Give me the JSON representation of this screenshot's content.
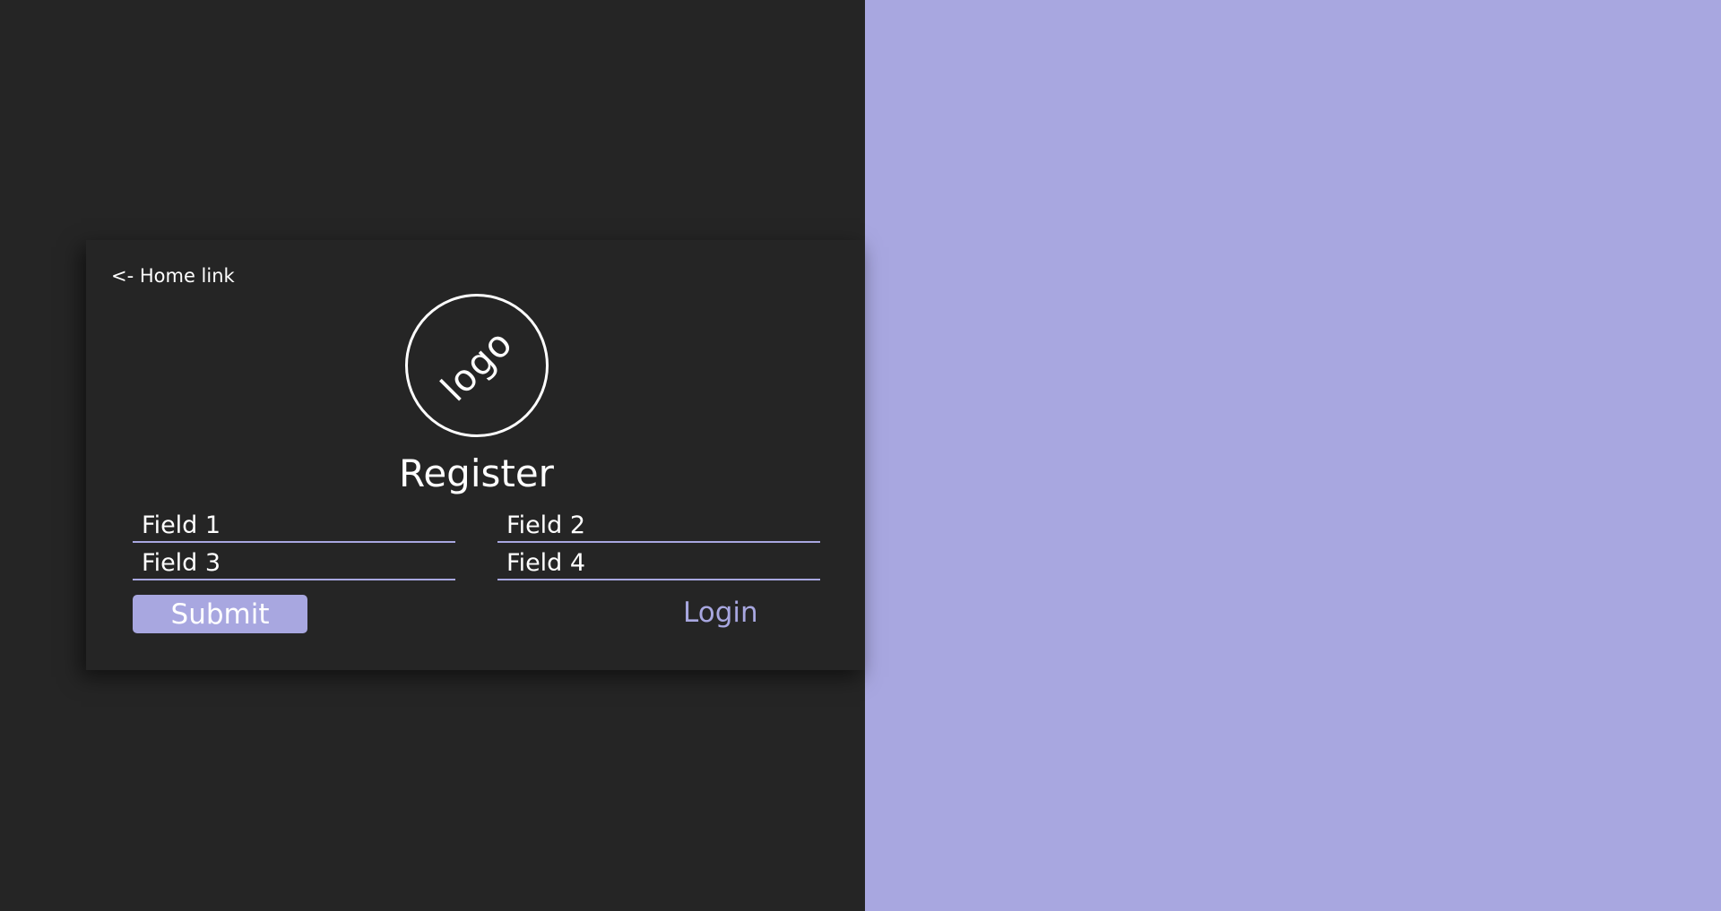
{
  "colors": {
    "background": "#252525",
    "accent": "#a8a7e0",
    "text": "#ffffff"
  },
  "nav": {
    "home_link": "<- Home link"
  },
  "logo": {
    "text": "logo"
  },
  "form": {
    "title": "Register",
    "fields": [
      {
        "placeholder": "Field 1"
      },
      {
        "placeholder": "Field 2"
      },
      {
        "placeholder": "Field 3"
      },
      {
        "placeholder": "Field 4"
      }
    ],
    "submit_label": "Submit",
    "login_label": "Login"
  }
}
